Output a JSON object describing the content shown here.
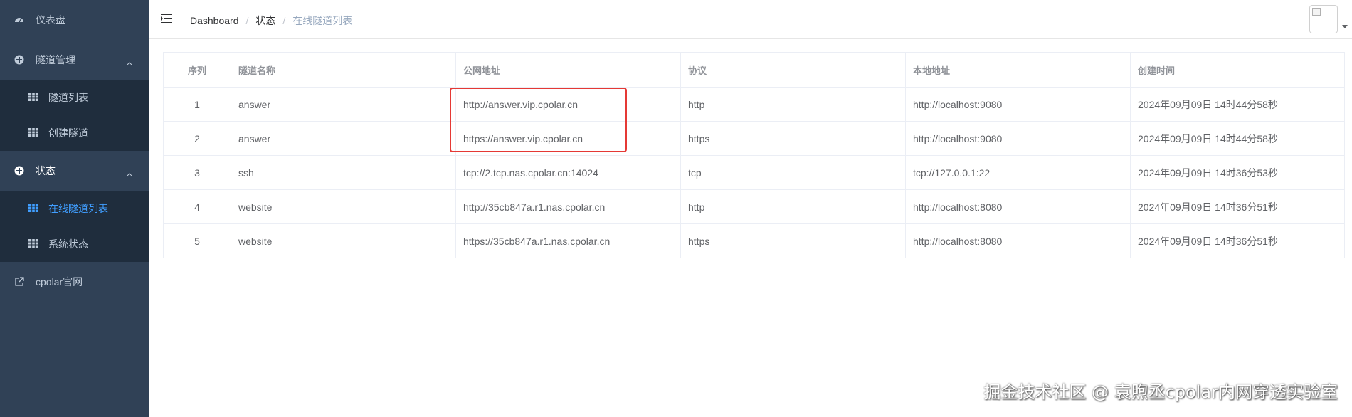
{
  "sidebar": {
    "items": [
      {
        "label": "仪表盘",
        "icon": "dashboard-icon"
      },
      {
        "label": "隧道管理",
        "icon": "plus-circle-icon",
        "expanded": true,
        "children": [
          {
            "label": "隧道列表",
            "icon": "grid-icon"
          },
          {
            "label": "创建隧道",
            "icon": "grid-icon"
          }
        ]
      },
      {
        "label": "状态",
        "icon": "plus-circle-icon",
        "expanded": true,
        "children": [
          {
            "label": "在线隧道列表",
            "icon": "grid-icon",
            "active": true
          },
          {
            "label": "系统状态",
            "icon": "grid-icon"
          }
        ]
      },
      {
        "label": "cpolar官网",
        "icon": "external-link-icon"
      }
    ]
  },
  "header": {
    "breadcrumb": [
      "Dashboard",
      "状态",
      "在线隧道列表"
    ]
  },
  "table": {
    "columns": [
      "序列",
      "隧道名称",
      "公网地址",
      "协议",
      "本地地址",
      "创建时间"
    ],
    "rows": [
      [
        "1",
        "answer",
        "http://answer.vip.cpolar.cn",
        "http",
        "http://localhost:9080",
        "2024年09月09日 14时44分58秒"
      ],
      [
        "2",
        "answer",
        "https://answer.vip.cpolar.cn",
        "https",
        "http://localhost:9080",
        "2024年09月09日 14时44分58秒"
      ],
      [
        "3",
        "ssh",
        "tcp://2.tcp.nas.cpolar.cn:14024",
        "tcp",
        "tcp://127.0.0.1:22",
        "2024年09月09日 14时36分53秒"
      ],
      [
        "4",
        "website",
        "http://35cb847a.r1.nas.cpolar.cn",
        "http",
        "http://localhost:8080",
        "2024年09月09日 14时36分51秒"
      ],
      [
        "5",
        "website",
        "https://35cb847a.r1.nas.cpolar.cn",
        "https",
        "http://localhost:8080",
        "2024年09月09日 14时36分51秒"
      ]
    ]
  },
  "watermark": "掘金技术社区 @ 袁煦丞cpolar内网穿透实验室",
  "colors": {
    "sidebar_bg": "#304156",
    "submenu_bg": "#1f2d3d",
    "active": "#409eff",
    "highlight": "#e53935"
  }
}
